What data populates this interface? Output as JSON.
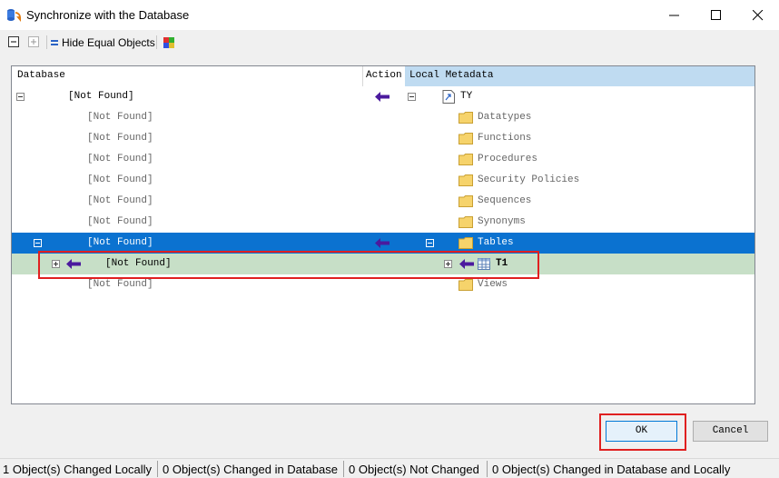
{
  "window": {
    "title": "Synchronize with the Database"
  },
  "toolbar": {
    "hide_equal_label": "Hide Equal Objects"
  },
  "tree": {
    "columns": {
      "database": "Database",
      "action": "Action",
      "local": "Local Metadata"
    },
    "root": {
      "database": "[Not Found]",
      "local": "TY"
    },
    "folders": [
      {
        "database": "[Not Found]",
        "local": "Datatypes"
      },
      {
        "database": "[Not Found]",
        "local": "Functions"
      },
      {
        "database": "[Not Found]",
        "local": "Procedures"
      },
      {
        "database": "[Not Found]",
        "local": "Security Policies"
      },
      {
        "database": "[Not Found]",
        "local": "Sequences"
      },
      {
        "database": "[Not Found]",
        "local": "Synonyms"
      }
    ],
    "tables": {
      "database": "[Not Found]",
      "local": "Tables"
    },
    "t1": {
      "database": "[Not Found]",
      "local": "T1"
    },
    "views": {
      "database": "[Not Found]",
      "local": "Views"
    }
  },
  "buttons": {
    "ok": "OK",
    "cancel": "Cancel"
  },
  "status": [
    "1 Object(s) Changed Locally",
    "0 Object(s) Changed in Database",
    "0 Object(s) Not Changed",
    "0 Object(s) Changed in Database and Locally"
  ],
  "colors": {
    "selection": "#0b72d0",
    "changed_row": "#c7dfc7",
    "arrow": "#4b1a9e",
    "highlight": "#e02020"
  }
}
